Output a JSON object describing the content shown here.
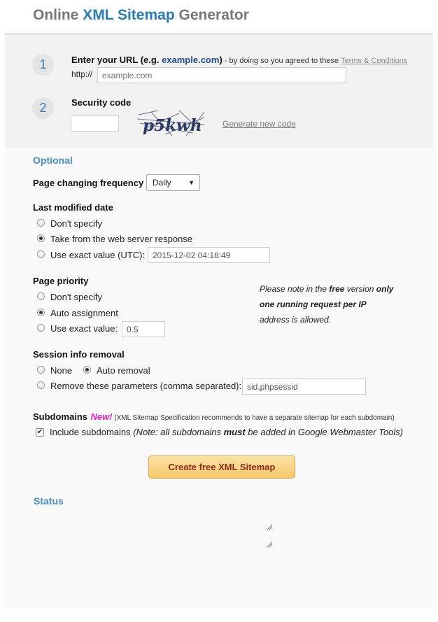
{
  "header": {
    "title_part1": "Online ",
    "title_highlight": "XML Sitemap",
    "title_part2": " Generator"
  },
  "step1": {
    "number": "1",
    "label": "Enter your URL (e.g. ",
    "example": "example.com",
    "label_close": ")",
    "agreement": " - by doing so you agreed to these ",
    "terms_link": "Terms & Conditions",
    "prefix": "http://",
    "url_placeholder": "example.com"
  },
  "step2": {
    "number": "2",
    "label": "Security code",
    "captcha_text": "p5kwh",
    "generate_link": "Generate new code"
  },
  "optional": {
    "title": "Optional",
    "frequency": {
      "label": "Page changing frequency",
      "selected": "Daily"
    },
    "last_modified": {
      "title": "Last modified date",
      "opt1": "Don't specify",
      "opt2": "Take from the web server response",
      "opt3": "Use exact value (UTC):",
      "exact_value": "2015-12-02 04:18:49"
    },
    "priority": {
      "title": "Page priority",
      "opt1": "Don't specify",
      "opt2": "Auto assignment",
      "opt3": "Use exact value:",
      "exact_value": "0.5"
    },
    "note": {
      "line1_a": "Please note in the ",
      "line1_b": "free",
      "line1_c": " version ",
      "line1_d": "only",
      "line2": "one running request per IP",
      "line3": "address is allowed."
    },
    "session": {
      "title": "Session info removal",
      "opt_none": "None",
      "opt_auto": "Auto removal",
      "opt_remove": "Remove these parameters (comma separated):",
      "params_value": "sid,phpsessid"
    },
    "subdomains": {
      "title": "Subdomains",
      "new_tag": "New!",
      "spec_note": " (XML Sitemap Specification recommends to have a separate sitemap for each subdomain)",
      "include_label": "Include subdomains",
      "include_note_a": " (Note: all subdomains ",
      "include_note_b": "must",
      "include_note_c": " be added in Google Webmaster Tools)",
      "include_checked": true
    }
  },
  "create_button": "Create free XML Sitemap",
  "status": {
    "title": "Status"
  },
  "colors": {
    "accent_blue": "#2b7bb3",
    "section_blue": "#4a8cc0",
    "button_text": "#8b2a1b",
    "new_tag": "#e020c0"
  }
}
